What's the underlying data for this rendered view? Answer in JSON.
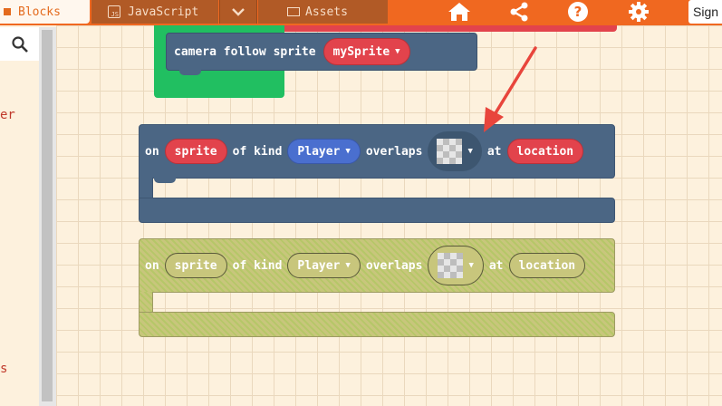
{
  "topbar": {
    "tabs": [
      {
        "label": "Blocks"
      },
      {
        "label": "JavaScript"
      },
      {
        "label": "Assets"
      }
    ],
    "signin_label": "Sign",
    "colors": {
      "bar": "#f06820",
      "active_tab": "#fff7ee",
      "inactive_tab": "#b15a26"
    }
  },
  "sidebar": {
    "category_partials": [
      "er",
      "s"
    ]
  },
  "workspace": {
    "camera_block": {
      "text": "camera follow sprite",
      "variable": "mySprite"
    },
    "event_block": {
      "kw_on": "on",
      "sprite_label": "sprite",
      "kw_of_kind": "of kind",
      "kind_value": "Player",
      "kw_overlaps": "overlaps",
      "kw_at": "at",
      "location_label": "location"
    },
    "event_block_ghost": {
      "kw_on": "on",
      "sprite_label": "sprite",
      "kw_of_kind": "of kind",
      "kind_value": "Player",
      "kw_overlaps": "overlaps",
      "kw_at": "at",
      "location_label": "location"
    },
    "colors": {
      "sprite_block": "#4b6684",
      "variable_pill": "#e2434c",
      "kind_pill": "#4a6fcf",
      "green_container": "#21bf61",
      "ghost_block": "#c8c67c",
      "annotation_arrow": "#e8453c"
    }
  },
  "icons": [
    "search-icon",
    "home-icon",
    "share-icon",
    "help-icon",
    "gear-icon",
    "chevron-down-icon",
    "tile-picker-icon"
  ]
}
